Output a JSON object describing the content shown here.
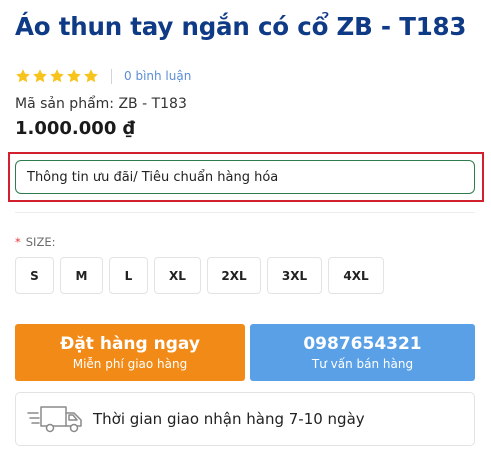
{
  "product": {
    "title": "Áo thun tay ngắn có cổ ZB - T183",
    "rating_stars": 5,
    "review_link": "0 bình luận",
    "sku": "Mã sản phẩm: ZB - T183",
    "price": "1.000.000 ₫"
  },
  "promo": {
    "label": "Thông tin ưu đãi/ Tiêu chuẩn hàng hóa"
  },
  "size_selector": {
    "required_mark": "*",
    "label": "SIZE:",
    "options": [
      "S",
      "M",
      "L",
      "XL",
      "2XL",
      "3XL",
      "4XL"
    ]
  },
  "actions": {
    "order": {
      "main": "Đặt hàng ngay",
      "sub": "Miễn phí giao hàng"
    },
    "call": {
      "main": "0987654321",
      "sub": "Tư vấn bán hàng"
    }
  },
  "delivery": {
    "icon": "truck-icon",
    "text": "Thời gian giao nhận hàng 7-10 ngày"
  },
  "colors": {
    "title": "#0e3a86",
    "star": "#f7c41e",
    "order_button": "#f28a17",
    "call_button": "#5aa0e6",
    "promo_border": "#2e7d4f",
    "highlight_outline": "#d3202f"
  }
}
